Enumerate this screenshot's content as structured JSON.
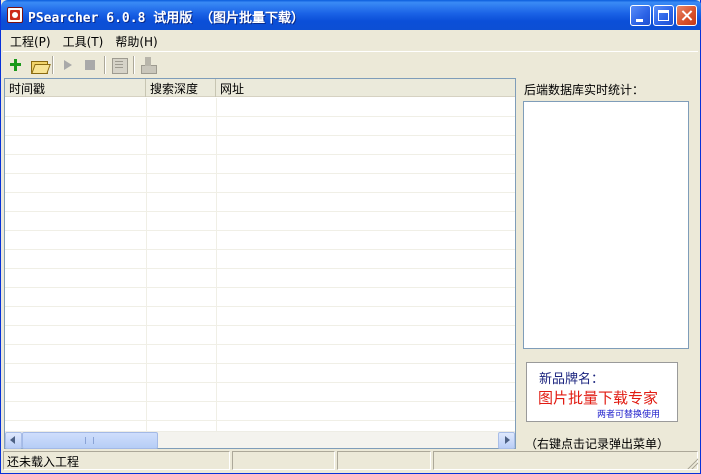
{
  "window": {
    "title": "PSearcher 6.0.8 试用版 （图片批量下载）"
  },
  "menu": {
    "items": [
      "工程(P)",
      "工具(T)",
      "帮助(H)"
    ]
  },
  "toolbar": {
    "buttons": [
      "new-project",
      "open-project",
      "start",
      "stop",
      "properties",
      "export"
    ]
  },
  "list": {
    "columns": [
      "时间戳",
      "搜索深度",
      "网址"
    ],
    "rows": []
  },
  "stats": {
    "label": "后端数据库实时统计："
  },
  "brand": {
    "title": "新品牌名：",
    "name": "图片批量下载专家",
    "note": "两者可替换使用"
  },
  "hint": {
    "text": "（右键点击记录弹出菜单）"
  },
  "statusbar": {
    "message": "还未载入工程",
    "cells": [
      "",
      "",
      "",
      ""
    ]
  },
  "colors": {
    "titlebar": "#0b4fd8",
    "brand_title": "#1a237e",
    "brand_name": "#e11b12",
    "brand_note": "#2222cc",
    "face": "#ece9d8"
  }
}
